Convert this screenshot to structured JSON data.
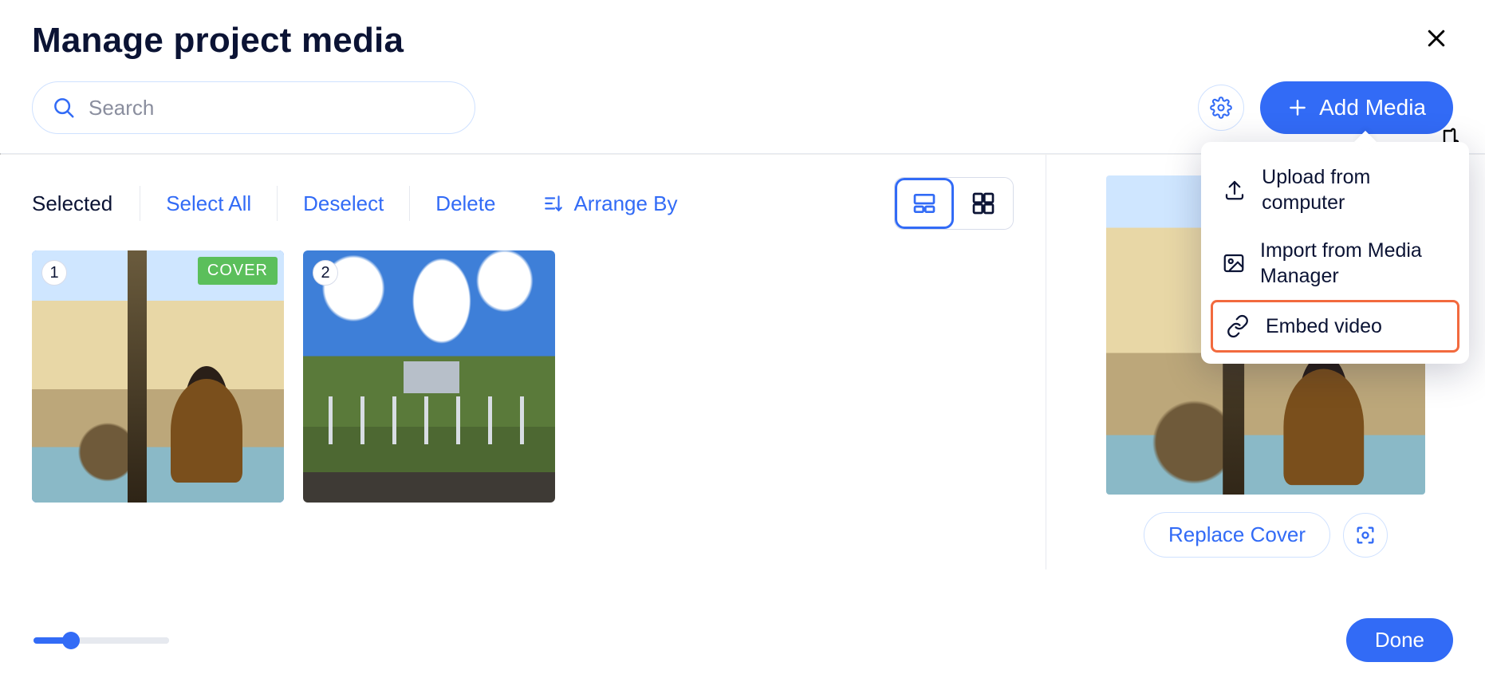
{
  "title": "Manage project media",
  "search": {
    "placeholder": "Search",
    "value": ""
  },
  "buttons": {
    "add_media": "Add Media",
    "done": "Done",
    "replace_cover": "Replace Cover"
  },
  "toolbar": {
    "selected_label": "Selected",
    "select_all": "Select All",
    "deselect": "Deselect",
    "delete": "Delete",
    "arrange_by": "Arrange By"
  },
  "view": {
    "active": "large"
  },
  "media": {
    "items": [
      {
        "index": "1",
        "is_cover": true,
        "cover_label": "COVER",
        "selected": true
      },
      {
        "index": "2",
        "is_cover": false,
        "selected": false
      }
    ]
  },
  "dropdown": {
    "items": [
      {
        "label": "Upload from computer",
        "icon": "upload-icon"
      },
      {
        "label": "Import from Media Manager",
        "icon": "image-icon"
      },
      {
        "label": "Embed video",
        "icon": "link-icon",
        "highlight": true
      }
    ]
  },
  "zoom": {
    "value": 24,
    "min": 0,
    "max": 100
  },
  "colors": {
    "primary": "#326bf6",
    "highlight_border": "#f26a3e",
    "cover_badge": "#5bbf5b"
  }
}
